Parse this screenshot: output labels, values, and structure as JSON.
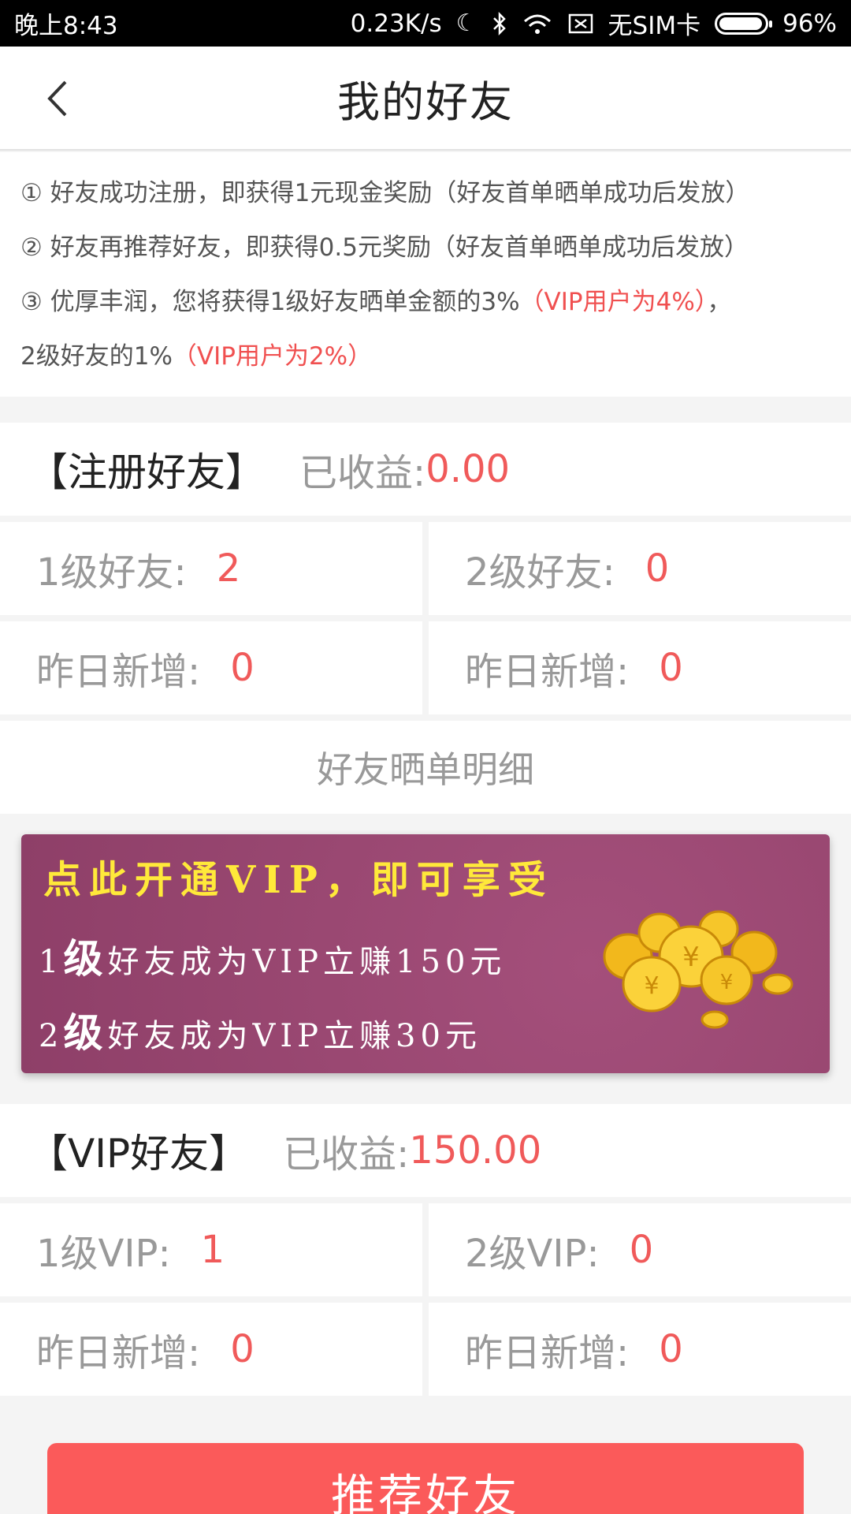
{
  "status_bar": {
    "time": "晚上8:43",
    "speed": "0.23K/s",
    "sim": "无SIM卡",
    "battery": "96%"
  },
  "header": {
    "title": "我的好友"
  },
  "rules": [
    {
      "text": "① 好友成功注册，即获得1元现金奖励（好友首单晒单成功后发放）"
    },
    {
      "text": "② 好友再推荐好友，即获得0.5元奖励（好友首单晒单成功后发放）"
    },
    {
      "text": "③ 优厚丰润，您将获得1级好友晒单金额的3%",
      "highlight": "（VIP用户为4%）",
      "tail": "，"
    },
    {
      "text": "2级好友的1%",
      "highlight": "（VIP用户为2%）"
    }
  ],
  "register_section": {
    "title": "【注册好友】",
    "earned_label": "已收益:",
    "earned_value": "0.00",
    "level1_label": "1级好友:",
    "level1_value": "2",
    "level2_label": "2级好友:",
    "level2_value": "0",
    "yesterday_label": "昨日新增:",
    "yesterday1_value": "0",
    "yesterday2_value": "0"
  },
  "detail_link": "好友晒单明细",
  "vip_banner": {
    "line1": "点此开通VIP，即可享受",
    "line2_prefix": "1",
    "line2_big": "级",
    "line2_rest": "好友成为VIP立赚150元",
    "line3_prefix": "2",
    "line3_big": "级",
    "line3_rest": "好友成为VIP立赚30元"
  },
  "vip_section": {
    "title": "【VIP好友】",
    "earned_label": "已收益:",
    "earned_value": "150.00",
    "level1_label": "1级VIP:",
    "level1_value": "1",
    "level2_label": "2级VIP:",
    "level2_value": "0",
    "yesterday_label": "昨日新增:",
    "yesterday1_value": "0",
    "yesterday2_value": "0"
  },
  "cta": {
    "label": "推荐好友"
  },
  "colors": {
    "accent": "#f05a5a",
    "cta": "#fb5a5a",
    "banner": "#9a4872",
    "banner_title": "#ffe93a"
  }
}
